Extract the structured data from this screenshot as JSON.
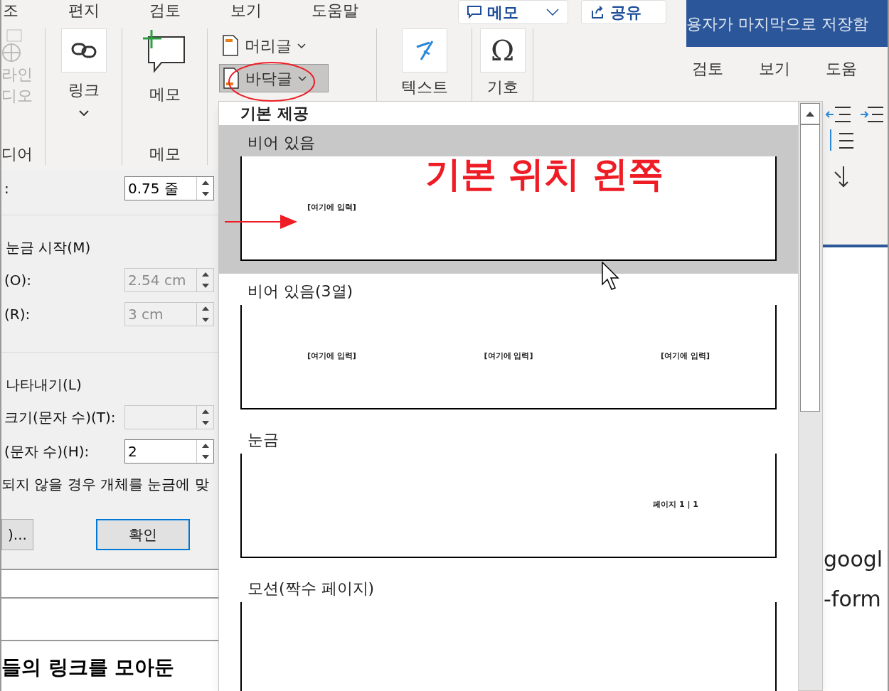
{
  "ribbon": {
    "tabs": [
      "조",
      "편지",
      "검토",
      "보기",
      "도움말"
    ],
    "memo_button": "메모",
    "share_button": "공유",
    "media_group": {
      "labels": [
        "라인",
        "디오"
      ],
      "group_label": "디어"
    },
    "link": {
      "label": "링크"
    },
    "comment": {
      "label": "메모",
      "group_label": "메모"
    },
    "header_footer": [
      {
        "label": "머리글",
        "selected": false
      },
      {
        "label": "바닥글",
        "selected": true
      }
    ],
    "text_box": {
      "label": "텍스트"
    },
    "symbol": {
      "label": "기호",
      "glyph": "Ω"
    }
  },
  "back_window": {
    "title": "용자가 마지막으로 저장함",
    "tabs": [
      "검토",
      "보기",
      "도움"
    ],
    "lines": [
      "googl",
      "-form"
    ]
  },
  "dialog": {
    "sections": [
      [
        {
          "kind": "field",
          "label": ":",
          "value": "0.75 줄",
          "disabled": false
        }
      ],
      [
        {
          "kind": "heading",
          "label": "눈금 시작(M)"
        },
        {
          "kind": "field",
          "label": "(O):",
          "value": "2.54 cm",
          "disabled": true
        },
        {
          "kind": "field",
          "label": "(R):",
          "value": "3 cm",
          "disabled": true
        }
      ],
      [
        {
          "kind": "heading",
          "label": "나타내기(L)"
        },
        {
          "kind": "field",
          "label": "크기(문자 수)(T):",
          "disabled": true
        },
        {
          "kind": "field",
          "label": "(문자 수)(H):",
          "value": "2",
          "disabled": false
        },
        {
          "kind": "note",
          "label": "되지 않을 경우 개체를 눈금에 맞"
        }
      ]
    ],
    "buttons": [
      {
        "label": ")...",
        "default": false
      },
      {
        "label": "확인",
        "default": true
      }
    ]
  },
  "document": {
    "text": "들의 링크를 모아둔"
  },
  "gallery": {
    "heading": "기본 제공",
    "items": [
      {
        "label": "비어 있음",
        "selected": true,
        "preview": {
          "kind": "left",
          "texts": [
            "[여기에 입력]"
          ]
        }
      },
      {
        "label": "비어 있음(3열)",
        "selected": false,
        "preview": {
          "kind": "columns",
          "texts": [
            "[여기에 입력]",
            "[여기에 입력]",
            "[여기에 입력]"
          ]
        }
      },
      {
        "label": "눈금",
        "selected": false,
        "preview": {
          "kind": "right",
          "texts": [
            "페이지 1 | 1"
          ]
        }
      },
      {
        "label": "모션(짝수 페이지)",
        "selected": false,
        "preview": {
          "kind": "empty"
        }
      }
    ]
  },
  "annotation": {
    "label": "기본 위치 왼쪽"
  }
}
